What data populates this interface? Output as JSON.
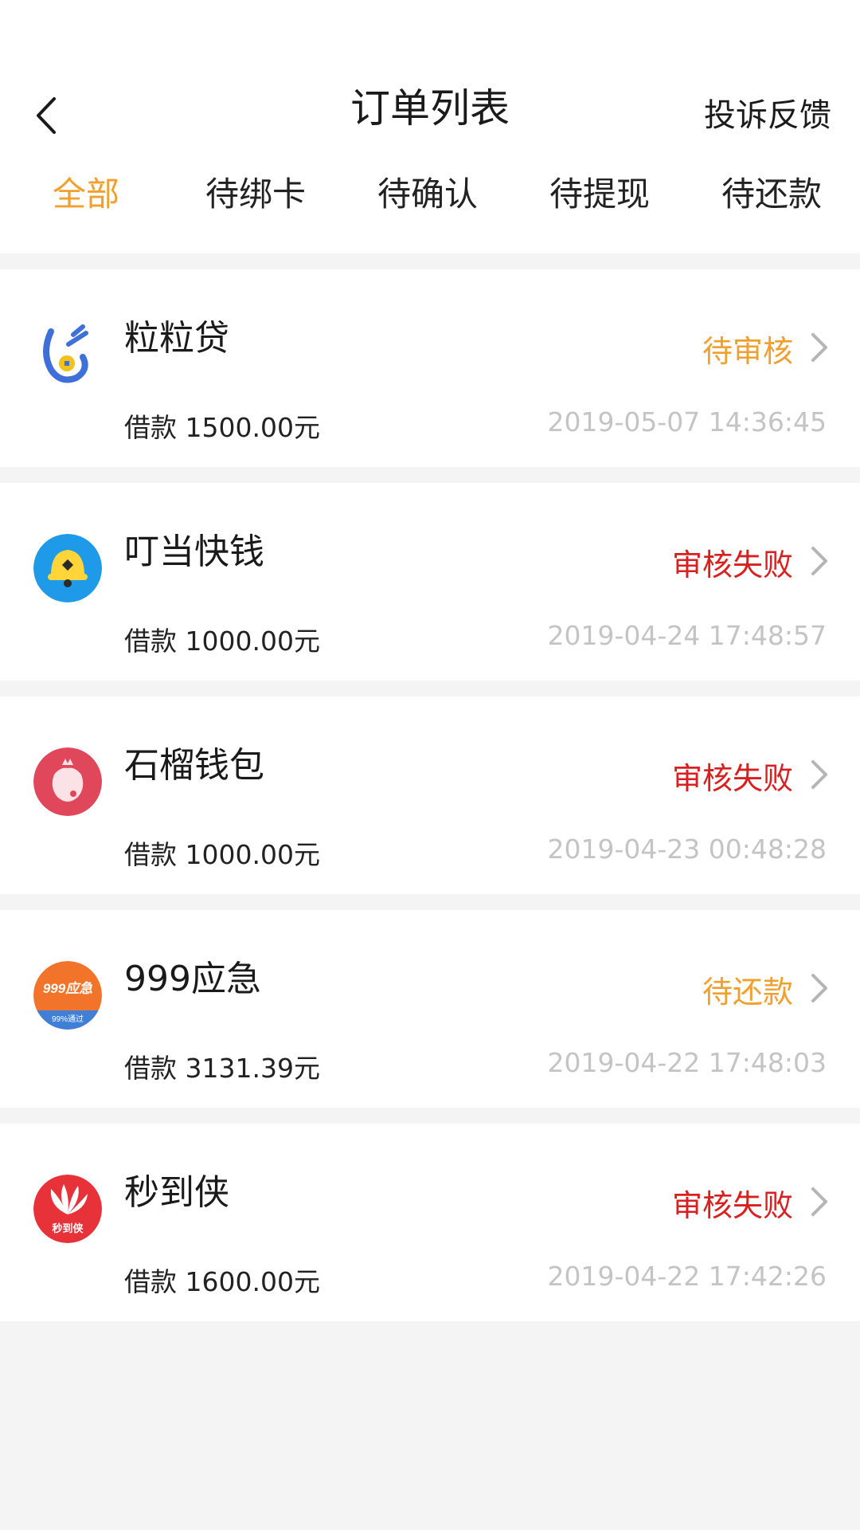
{
  "header": {
    "title": "订单列表",
    "feedback_label": "投诉反馈",
    "back_icon": "chevron-left-icon"
  },
  "tabs": [
    {
      "label": "全部",
      "active": true
    },
    {
      "label": "待绑卡",
      "active": false
    },
    {
      "label": "待确认",
      "active": false
    },
    {
      "label": "待提现",
      "active": false
    },
    {
      "label": "待还款",
      "active": false
    }
  ],
  "colors": {
    "accent": "#f0a02f",
    "fail": "#d9201f",
    "pending": "#f0a02f",
    "time": "#c4c4c4",
    "background": "#f4f4f4"
  },
  "orders": [
    {
      "name": "粒粒贷",
      "status": "待审核",
      "status_color": "#f0a02f",
      "amount": "借款 1500.00元",
      "time": "2019-05-07 14:36:45",
      "logo": "lilidai-logo"
    },
    {
      "name": "叮当快钱",
      "status": "审核失败",
      "status_color": "#d9201f",
      "amount": "借款 1000.00元",
      "time": "2019-04-24 17:48:57",
      "logo": "bell-logo"
    },
    {
      "name": "石榴钱包",
      "status": "审核失败",
      "status_color": "#d9201f",
      "amount": "借款 1000.00元",
      "time": "2019-04-23 00:48:28",
      "logo": "pomegranate-logo"
    },
    {
      "name": "999应急",
      "status": "待还款",
      "status_color": "#f0a02f",
      "amount": "借款 3131.39元",
      "time": "2019-04-22 17:48:03",
      "logo": "999-logo",
      "logo_text": "999应急",
      "logo_subtext": "99%通过"
    },
    {
      "name": "秒到侠",
      "status": "审核失败",
      "status_color": "#d9201f",
      "amount": "借款 1600.00元",
      "time": "2019-04-22 17:42:26",
      "logo": "miaodaoxia-logo",
      "logo_text": "秒到侠"
    }
  ]
}
